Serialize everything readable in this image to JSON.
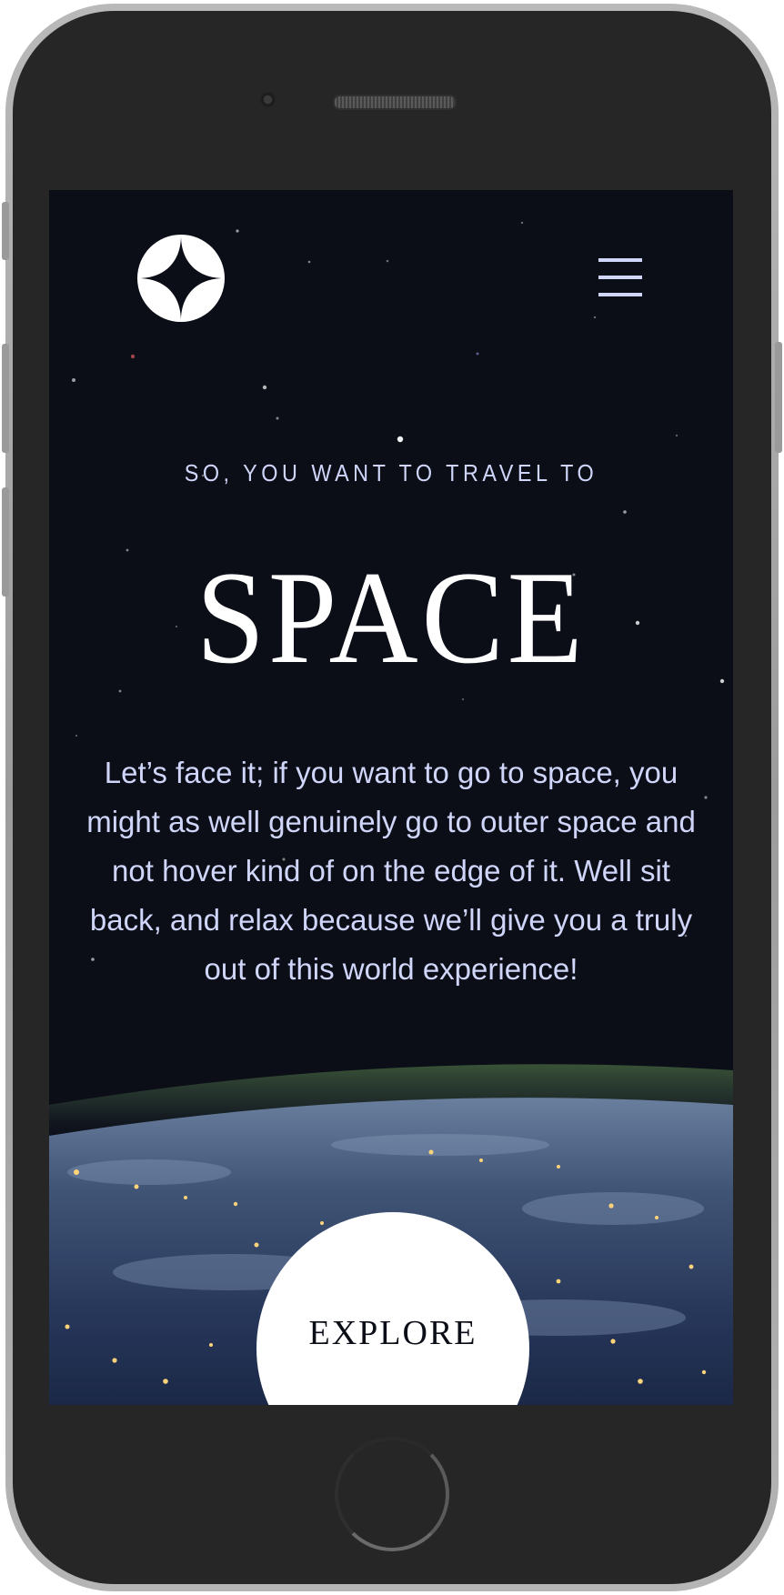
{
  "device": {
    "frame": "phone"
  },
  "header": {
    "logo_icon": "four-point-star-logo",
    "menu_icon": "hamburger-menu-icon"
  },
  "hero": {
    "eyebrow": "SO, YOU WANT TO TRAVEL TO",
    "title": "SPACE",
    "body": "Let’s face it; if you want to go to space, you might as well genuinely go to outer space and not hover kind of on the edge of it. Well sit back, and relax because we’ll give you a truly out of this world experience!",
    "cta_label": "EXPLORE"
  },
  "colors": {
    "background": "#0b0d17",
    "text_light": "#d0d6f9",
    "white": "#ffffff"
  }
}
